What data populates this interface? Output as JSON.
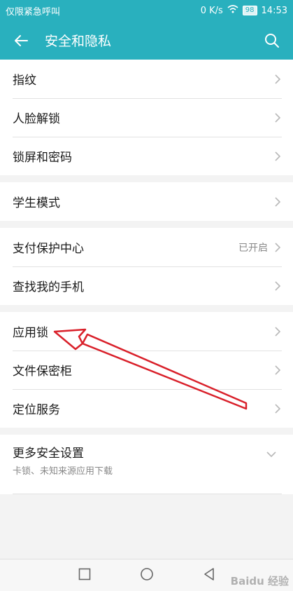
{
  "status_bar": {
    "left_text": "仅限紧急呼叫",
    "network_speed": "0 K/s",
    "battery": "98",
    "time": "14:53"
  },
  "app_bar": {
    "title": "安全和隐私",
    "back_icon": "back-arrow-icon",
    "search_icon": "search-icon"
  },
  "groups": [
    {
      "items": [
        {
          "label": "指纹"
        },
        {
          "label": "人脸解锁"
        },
        {
          "label": "锁屏和密码"
        }
      ]
    },
    {
      "items": [
        {
          "label": "学生模式"
        }
      ]
    },
    {
      "items": [
        {
          "label": "支付保护中心",
          "value": "已开启"
        },
        {
          "label": "查找我的手机"
        }
      ]
    },
    {
      "items": [
        {
          "label": "应用锁"
        },
        {
          "label": "文件保密柜"
        },
        {
          "label": "定位服务"
        }
      ]
    }
  ],
  "more_settings": {
    "title": "更多安全设置",
    "subtitle": "卡锁、未知来源应用下载"
  },
  "watermark": "Baidu 经验",
  "colors": {
    "accent": "#29b0be",
    "annotation_arrow": "#d9202a"
  }
}
